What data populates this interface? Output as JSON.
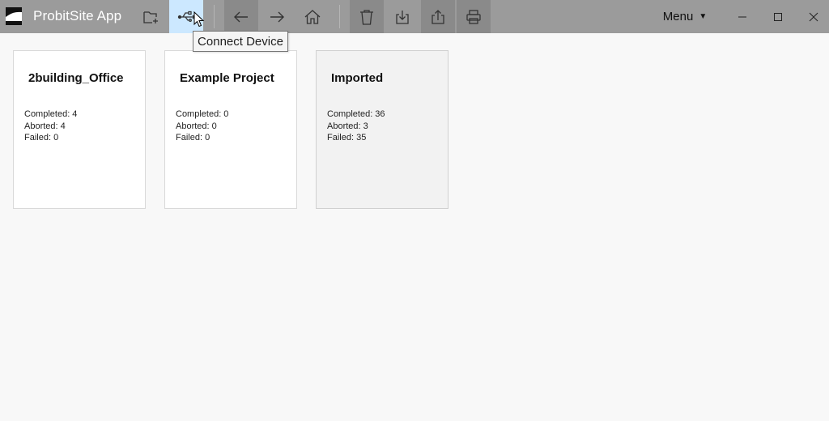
{
  "app": {
    "title": "ProbitSite App"
  },
  "toolbar": {
    "buttons": [
      {
        "name": "new-folder-button",
        "icon": "folder-plus-icon"
      },
      {
        "name": "connect-device-button",
        "icon": "usb-icon",
        "highlighted": true
      },
      {
        "name": "back-button",
        "icon": "arrow-left-icon"
      },
      {
        "name": "forward-button",
        "icon": "arrow-right-icon"
      },
      {
        "name": "home-button",
        "icon": "home-icon"
      },
      {
        "name": "delete-button",
        "icon": "trash-icon"
      },
      {
        "name": "download-button",
        "icon": "download-icon"
      },
      {
        "name": "share-button",
        "icon": "share-icon"
      },
      {
        "name": "print-button",
        "icon": "printer-icon"
      }
    ],
    "menu_label": "Menu",
    "menu_caret": "▼"
  },
  "tooltip": {
    "text": "Connect Device"
  },
  "colors": {
    "titlebar": "#9b9b9b",
    "highlight": "#cce8ff",
    "pressed": "#8a8a8a",
    "background": "#f8f8f8"
  },
  "projects": [
    {
      "title": "2building_Office",
      "completed": "Completed: 4",
      "aborted": "Aborted: 4",
      "failed": "Failed: 0"
    },
    {
      "title": "Example Project",
      "completed": "Completed: 0",
      "aborted": "Aborted: 0",
      "failed": "Failed: 0"
    },
    {
      "title": "Imported",
      "completed": "Completed: 36",
      "aborted": "Aborted: 3",
      "failed": "Failed: 35",
      "selected": true
    }
  ]
}
